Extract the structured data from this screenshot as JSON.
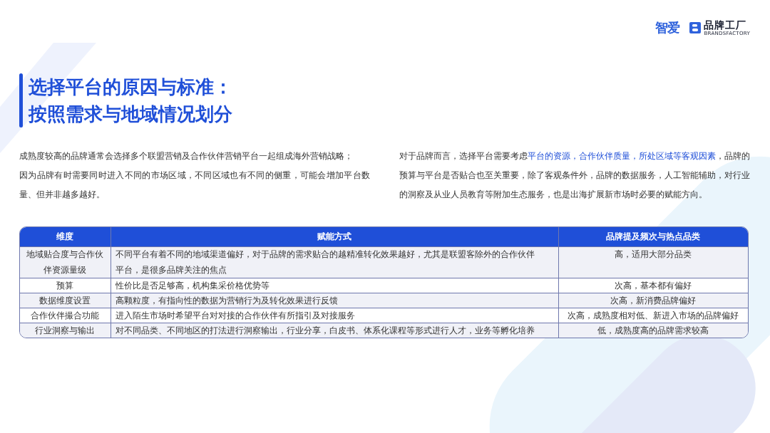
{
  "header": {
    "brand_primary": "智爱",
    "brand_secondary": {
      "name": "品牌工厂",
      "tagline": "BRANDSFACTORY"
    }
  },
  "title": {
    "lines": [
      "选择平台的原因与标准：",
      "按照需求与地域情况划分"
    ]
  },
  "text_columns": [
    {
      "paragraphs": [
        {
          "segments": [
            {
              "text": "成熟度较高的品牌通常会选择多个联盟营销及合作伙伴营销平台一起组成海外营销战略；",
              "highlight": false
            }
          ]
        },
        {
          "segments": [
            {
              "text": "因为品牌有时需要同时进入不同的市场区域，不同区域也有不同的侧重，可能会增加平台数量、但并非越多越好。",
              "highlight": false
            }
          ]
        }
      ]
    },
    {
      "paragraphs": [
        {
          "segments": [
            {
              "text": "对于品牌而言，选择平台需要考虑",
              "highlight": false
            },
            {
              "text": "平台的资源，合作伙伴质量，所处区域等客观因素",
              "highlight": true
            },
            {
              "text": "，品牌的预算与平台是否贴合也至关重要，除了客观条件外，品牌的数据服务，人工智能辅助，对行业的洞察及从业人员教育等附加生态服务，也是出海扩展新市场时必要的赋能方向。",
              "highlight": false
            }
          ]
        }
      ]
    }
  ],
  "table": {
    "columns": [
      "维度",
      "赋能方式",
      "品牌提及频次与热点品类"
    ],
    "rows": [
      {
        "shaded": true,
        "cells": [
          "地域贴合度与合作伙伴资源量级",
          "不同平台有着不同的地域渠道偏好，对于品牌的需求贴合的越精准转化效果越好，尤其是联盟客除外的合作伙伴平台，是很多品牌关注的焦点",
          "高，适用大部分品类"
        ]
      },
      {
        "shaded": false,
        "cells": [
          "预算",
          "性价比是否足够高，机构集采价格优势等",
          "次高，基本都有偏好"
        ]
      },
      {
        "shaded": true,
        "cells": [
          "数据维度设置",
          "高颗粒度，有指向性的数据为营销行为及转化效果进行反馈",
          "次高，新消费品牌偏好"
        ]
      },
      {
        "shaded": false,
        "cells": [
          "合作伙伴撮合功能",
          "进入陌生市场时希望平台对对接的合作伙伴有所指引及对接服务",
          "次高，成熟度相对低、新进入市场的品牌偏好"
        ]
      },
      {
        "shaded": true,
        "cells": [
          "行业洞察与输出",
          "对不同品类、不同地区的打法进行洞察输出，行业分享，白皮书、体系化课程等形式进行人才，业务等孵化培养",
          "低，成熟度高的品牌需求较高"
        ]
      }
    ]
  }
}
